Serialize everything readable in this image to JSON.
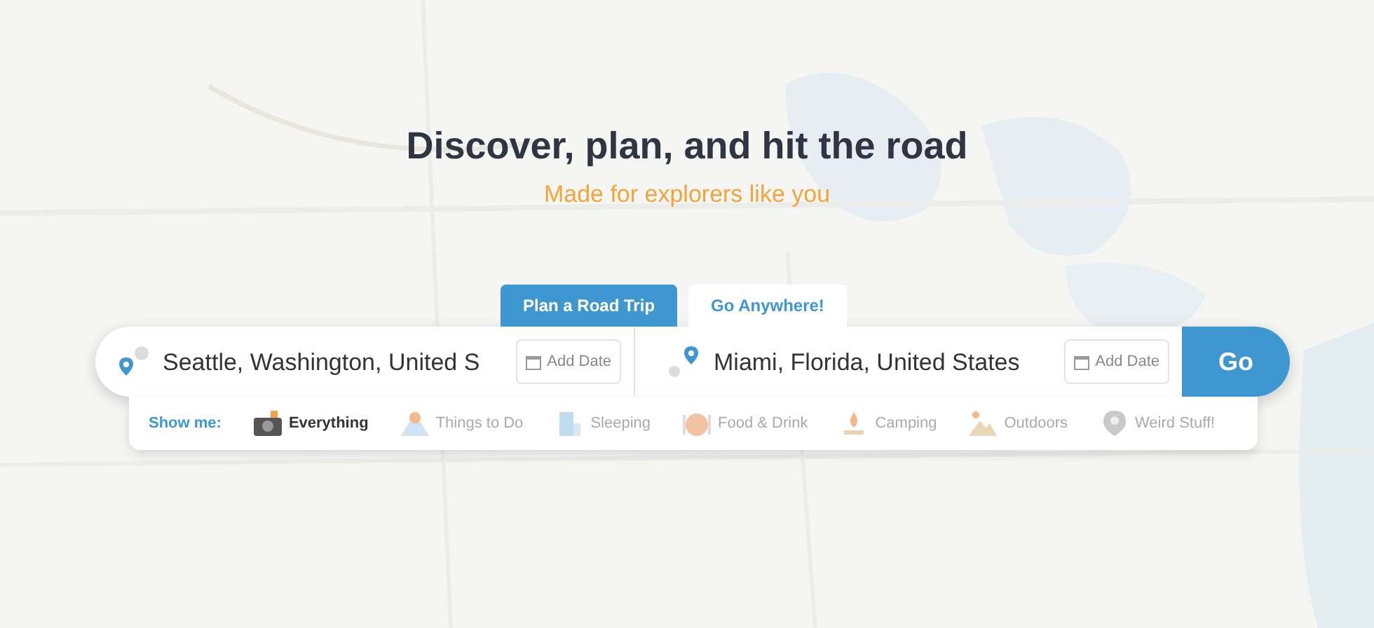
{
  "hero": {
    "title": "Discover, plan, and hit the road",
    "subtitle": "Made for explorers like you"
  },
  "tabs": [
    {
      "label": "Plan a Road Trip",
      "selected": true
    },
    {
      "label": "Go Anywhere!",
      "selected": false
    }
  ],
  "search": {
    "origin": {
      "value": "Seattle, Washington, United S",
      "date_label": "Add Date"
    },
    "destination": {
      "value": "Miami, Florida, United States",
      "date_label": "Add Date"
    },
    "go_label": "Go"
  },
  "filters": {
    "label": "Show me:",
    "categories": [
      {
        "label": "Everything",
        "kind": "everything",
        "selected": true
      },
      {
        "label": "Things to Do",
        "kind": "things",
        "selected": false
      },
      {
        "label": "Sleeping",
        "kind": "sleeping",
        "selected": false
      },
      {
        "label": "Food & Drink",
        "kind": "food",
        "selected": false
      },
      {
        "label": "Camping",
        "kind": "camping",
        "selected": false
      },
      {
        "label": "Outdoors",
        "kind": "outdoors",
        "selected": false
      },
      {
        "label": "Weird Stuff!",
        "kind": "weird",
        "selected": false
      }
    ]
  }
}
